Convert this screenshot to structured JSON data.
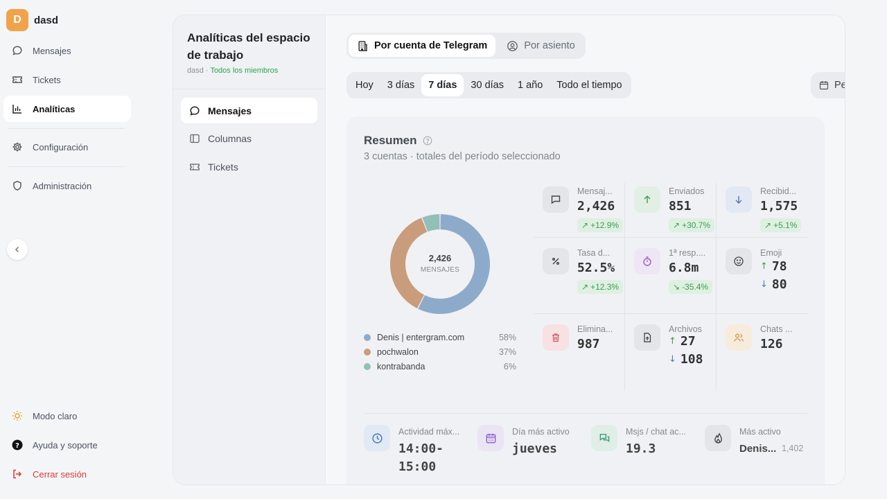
{
  "workspace": {
    "initial": "D",
    "name": "dasd"
  },
  "sidebar": {
    "items": [
      {
        "label": "Mensajes",
        "icon": "message-icon"
      },
      {
        "label": "Tickets",
        "icon": "ticket-icon"
      },
      {
        "label": "Analíticas",
        "icon": "chart-icon",
        "active": true
      },
      {
        "label": "Configuración",
        "icon": "gear-icon"
      },
      {
        "label": "Administración",
        "icon": "shield-icon"
      }
    ],
    "bottom": [
      {
        "label": "Modo claro",
        "icon": "sun-icon"
      },
      {
        "label": "Ayuda y soporte",
        "icon": "help-icon"
      },
      {
        "label": "Cerrar sesión",
        "icon": "logout-icon"
      }
    ]
  },
  "subnav": {
    "title": "Analíticas del espacio de trabajo",
    "workspace": "dasd",
    "separator": " · ",
    "scope": "Todos los miembros",
    "items": [
      {
        "label": "Mensajes",
        "active": true
      },
      {
        "label": "Columnas"
      },
      {
        "label": "Tickets"
      }
    ]
  },
  "toggle": {
    "options": [
      "Por cuenta de Telegram",
      "Por asiento"
    ],
    "selected": "Por cuenta de Telegram"
  },
  "ranges": {
    "options": [
      "Hoy",
      "3 días",
      "7 días",
      "30 días",
      "1 año",
      "Todo el tiempo"
    ],
    "selected": "7 días",
    "custom": "Personalizado"
  },
  "summary": {
    "title": "Resumen",
    "subtitle": "3 cuentas · totales del período seleccionado",
    "donut_value": "2,426",
    "donut_label": "MENSAJES"
  },
  "chart_data": {
    "type": "pie",
    "series": [
      {
        "name": "Denis | entergram.com",
        "value": 58,
        "label": "58%",
        "color": "#8eaacb"
      },
      {
        "name": "pochwalon",
        "value": 37,
        "label": "37%",
        "color": "#c99c7c"
      },
      {
        "name": "kontrabanda",
        "value": 6,
        "label": "6%",
        "color": "#93bfb9"
      }
    ],
    "center_value": "2,426",
    "center_label": "MENSAJES"
  },
  "metrics": [
    {
      "label": "Mensaj...",
      "value": "2,426",
      "badge": "+12.9%",
      "trend": "up"
    },
    {
      "label": "Enviados",
      "value": "851",
      "badge": "+30.7%",
      "trend": "up"
    },
    {
      "label": "Recibid...",
      "value": "1,575",
      "badge": "+5.1%",
      "trend": "up"
    },
    {
      "label": "Tasa d...",
      "value": "52.5%",
      "badge": "+12.3%",
      "trend": "up"
    },
    {
      "label": "1ª resp....",
      "value": "6.8m",
      "badge": "-35.4%",
      "trend": "down"
    },
    {
      "label": "Emoji",
      "up": "78",
      "down": "80"
    },
    {
      "label": "Elimina...",
      "value": "987"
    },
    {
      "label": "Archivos",
      "up": "27",
      "down": "108"
    },
    {
      "label": "Chats ...",
      "value": "126"
    }
  ],
  "stats": [
    {
      "label": "Actividad máx...",
      "value": "14:00-\n15:00"
    },
    {
      "label": "Día más activo",
      "value": "jueves"
    },
    {
      "label": "Msjs / chat ac...",
      "value": "19.3"
    },
    {
      "label": "Más activo",
      "value": "Denis...",
      "extra": "1,402"
    }
  ],
  "colors": {
    "accent_green": "#2ea44f",
    "danger": "#d73a3a",
    "badge_bg": "#def0e0",
    "badge_text": "#3f9a58"
  }
}
